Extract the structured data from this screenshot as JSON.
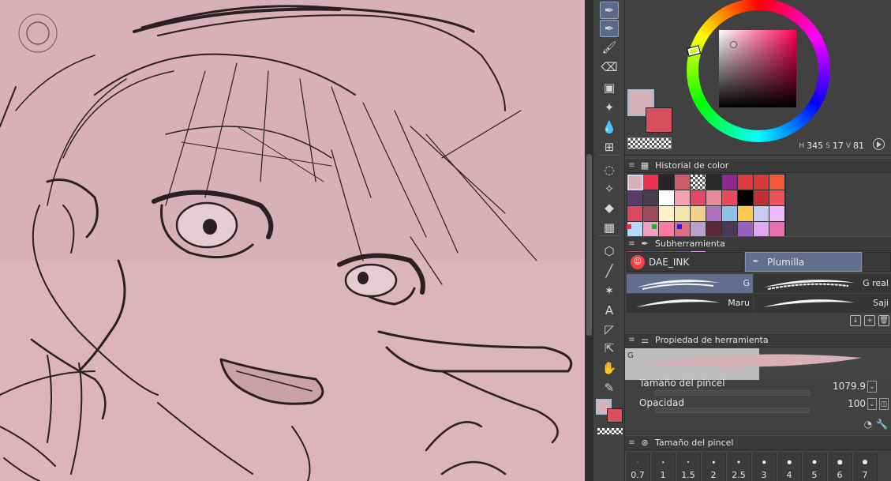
{
  "canvas": {
    "description": "",
    "bg_color": "#d8b0ba"
  },
  "toolbar": {
    "tools": [
      {
        "name": "pen-tool-icon",
        "glyph": "✒"
      },
      {
        "name": "pen-alt-icon",
        "glyph": "✒"
      },
      {
        "name": "brush-icon",
        "glyph": "🖌"
      },
      {
        "name": "eraser-icon",
        "glyph": "⌫"
      },
      {
        "name": "spray-icon",
        "glyph": "▣"
      },
      {
        "name": "sparkle-icon",
        "glyph": "✦"
      },
      {
        "name": "blend-icon",
        "glyph": "💧"
      },
      {
        "name": "grid-transform-icon",
        "glyph": "⊞"
      },
      {
        "name": "lasso-icon",
        "glyph": "◌"
      },
      {
        "name": "magic-wand-icon",
        "glyph": "✧"
      },
      {
        "name": "fill-bucket-icon",
        "glyph": "◆"
      },
      {
        "name": "gradient-icon",
        "glyph": "▦"
      },
      {
        "name": "figure-icon",
        "glyph": "⬡"
      },
      {
        "name": "line-icon",
        "glyph": "╱"
      },
      {
        "name": "ruler-icon",
        "glyph": "✶"
      },
      {
        "name": "text-icon",
        "glyph": "A"
      },
      {
        "name": "balloon-icon",
        "glyph": "◸"
      },
      {
        "name": "operation-icon",
        "glyph": "⇱"
      },
      {
        "name": "hand-icon",
        "glyph": "✋"
      },
      {
        "name": "eyedropper-icon",
        "glyph": "✎"
      }
    ],
    "main_color": "#d8b0ba",
    "sub_color": "#d7505f"
  },
  "color_wheel": {
    "main_color": "#d8b0ba",
    "sub_color": "#d7505f",
    "hue": "345",
    "saturation": "17",
    "value": "81",
    "sat_symbol": "S",
    "val_symbol": "V",
    "hue_symbol": "H"
  },
  "color_history": {
    "title": "Historial de color",
    "swatches": [
      "#d8b0ba",
      "#e8344f",
      "#2a2424",
      "#d05a6a",
      "checker",
      "#2a2a2a",
      "#8e2a8f",
      "#e03a3a",
      "#d93a3a",
      "#f05a3a",
      "#5a3a6a",
      "#4a3a4a",
      "#ffffff",
      "#f3a0b3",
      "#e04a68",
      "#e8899a",
      "#e84a5a",
      "#000000",
      "#c02f35",
      "#f05058",
      "#dd4a5f",
      "#9a4a5a",
      "#fff0c8",
      "#f2e6a8",
      "#f6d08a",
      "#b070c0",
      "#90c0e8",
      "#ffc850",
      "#c8c8f0",
      "#f0b8ff",
      "#b8d8ff",
      "#f0a0c0",
      "#ff7aa0",
      "#e06a8a",
      "#b8a0c8",
      "#5a2a3a",
      "#4a3a5a",
      "#9a60c0",
      "#e0a8f0",
      "#e870b0",
      "#b05060",
      "#3a5a7a",
      "#5a6a4a",
      "#6a5a8a",
      "#e8a0f8"
    ],
    "dots": [
      "#e03030",
      "#20b020",
      "#2020e0"
    ]
  },
  "subtool": {
    "title": "Subherramienta",
    "tabs": [
      {
        "label": "DAE_INK",
        "active": false
      },
      {
        "label": "Plumilla",
        "active": true
      }
    ],
    "brushes": [
      {
        "label": "G",
        "active": true
      },
      {
        "label": "G real",
        "active": false
      },
      {
        "label": "Maru",
        "active": false
      },
      {
        "label": "Saji",
        "active": false
      }
    ]
  },
  "tool_property": {
    "title": "Propiedad de herramienta",
    "preview_tag": "G",
    "brush_size_label": "Tamaño del pincel",
    "brush_size_value": "1079.9",
    "opacity_label": "Opacidad",
    "opacity_value": "100"
  },
  "brush_size": {
    "title": "Tamaño del pincel",
    "sizes": [
      "0.7",
      "1",
      "1.5",
      "2",
      "2.5",
      "3",
      "4",
      "5",
      "6",
      "7"
    ]
  }
}
